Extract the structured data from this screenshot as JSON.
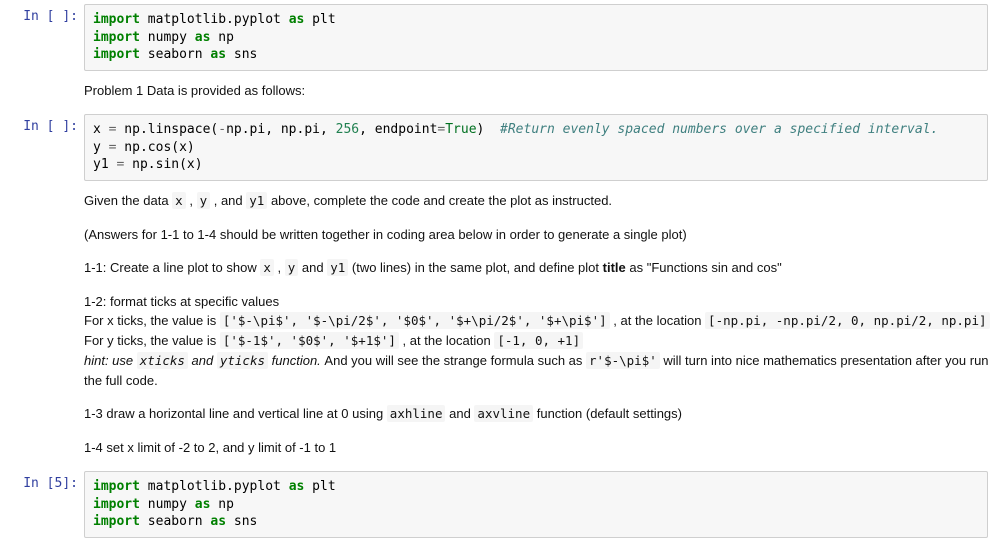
{
  "cells": {
    "c1": {
      "prompt": "In [ ]:",
      "code_html": "<span class=\"kw\">import</span> matplotlib.pyplot <span class=\"kw\">as</span> plt\n<span class=\"kw\">import</span> numpy <span class=\"kw\">as</span> np\n<span class=\"kw\">import</span> seaborn <span class=\"kw\">as</span> sns"
    },
    "m1": {
      "text": "Problem 1 Data is provided as follows:"
    },
    "c2": {
      "prompt": "In [ ]:",
      "code_html": "x <span class=\"op\">=</span> np.linspace(<span class=\"op\">-</span>np.pi, np.pi, <span class=\"num\">256</span>, endpoint<span class=\"op\">=</span><span class=\"bi\">True</span>)  <span class=\"cmt\">#Return evenly spaced numbers over a specified interval.</span>\ny <span class=\"op\">=</span> np.cos(x)\ny1 <span class=\"op\">=</span> np.sin(x)"
    },
    "m2": {
      "p1_pre": "Given the data ",
      "p1_c1": "x",
      "p1_mid1": " , ",
      "p1_c2": "y",
      "p1_mid2": " , and ",
      "p1_c3": "y1",
      "p1_post": " above, complete the code and create the plot as instructed.",
      "p2": "(Answers for 1-1 to 1-4 should be written together in coding area below in order to generate a single plot)",
      "p3_pre": "1-1: Create a line plot to show ",
      "p3_c1": "x",
      "p3_mid1": ", ",
      "p3_c2": "y",
      "p3_mid2": " and ",
      "p3_c3": "y1",
      "p3_mid3": " (two lines) in the same plot, and define plot ",
      "p3_bold": "title",
      "p3_post": " as \"Functions sin and cos\"",
      "p4a": "1-2: format ticks at specific values",
      "p4b_pre": "For x ticks, the value is ",
      "p4b_c1": "['$-\\pi$', '$-\\pi/2$', '$0$', '$+\\pi/2$', '$+\\pi$']",
      "p4b_mid": " , at the location ",
      "p4b_c2": "[-np.pi, -np.pi/2, 0, np.pi/2, np.pi]",
      "p4c_pre": "For y ticks, the value is ",
      "p4c_c1": "['$-1$', '$0$', '$+1$']",
      "p4c_mid": " , at the location ",
      "p4c_c2": "[-1, 0, +1]",
      "p4d_hint_pre": "hint: use ",
      "p4d_c1": "xticks",
      "p4d_mid1": " and ",
      "p4d_c2": "yticks",
      "p4d_mid2": " function.",
      "p4d_post1": " And you will see the strange formula such as ",
      "p4d_c3": "r'$-\\pi$'",
      "p4d_post2": " will turn into nice mathematics presentation after you run the full code.",
      "p5_pre": "1-3 draw a horizontal line and vertical line at 0 using ",
      "p5_c1": "axhline",
      "p5_mid": " and ",
      "p5_c2": "axvline",
      "p5_post": " function (default settings)",
      "p6": "1-4 set x limit of -2 to 2, and y limit of -1 to 1"
    },
    "c3": {
      "prompt": "In [5]:",
      "code_html": "<span class=\"kw\">import</span> matplotlib.pyplot <span class=\"kw\">as</span> plt\n<span class=\"kw\">import</span> numpy <span class=\"kw\">as</span> np\n<span class=\"kw\">import</span> seaborn <span class=\"kw\">as</span> sns"
    }
  }
}
